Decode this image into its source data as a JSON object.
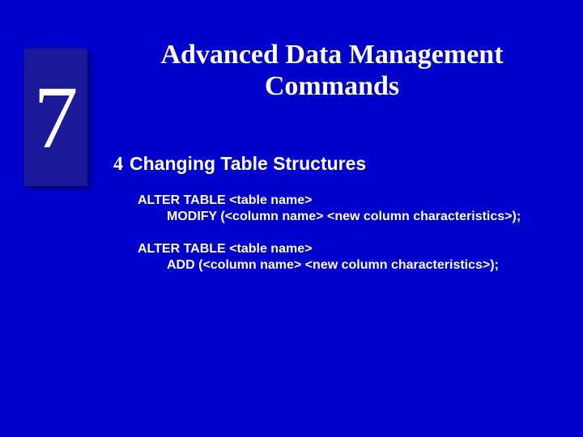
{
  "slide": {
    "number": "7",
    "title": "Advanced Data Management Commands"
  },
  "bullet": {
    "glyph": "4",
    "text": "Changing Table Structures"
  },
  "code1": {
    "line1": "ALTER TABLE <table name>",
    "line2": "MODIFY (<column name> <new column characteristics>);"
  },
  "code2": {
    "line1": "ALTER TABLE <table name>",
    "line2": "ADD (<column name> <new column characteristics>);"
  }
}
